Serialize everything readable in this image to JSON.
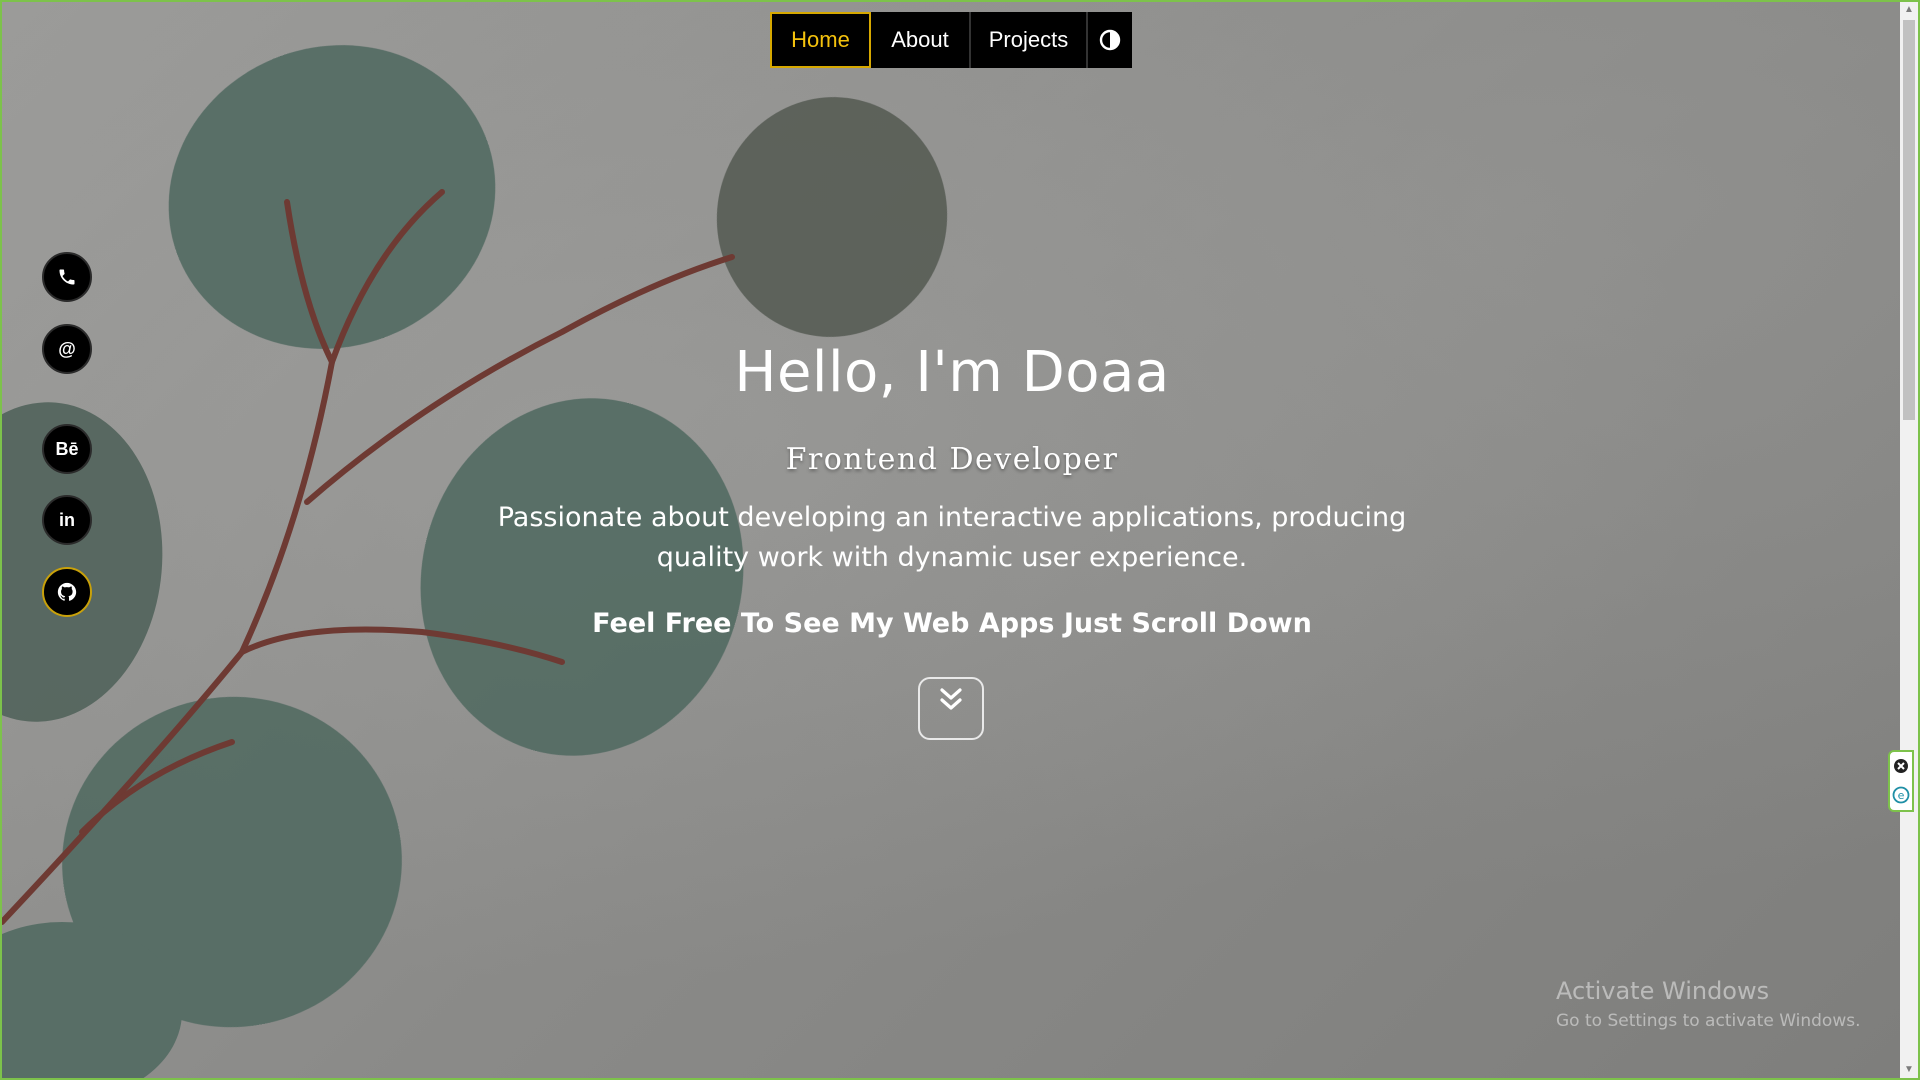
{
  "nav": {
    "items": [
      "Home",
      "About",
      "Projects"
    ],
    "active": "Home",
    "theme_toggle_icon": "contrast-icon"
  },
  "social": [
    {
      "name": "phone",
      "icon": "phone-icon"
    },
    {
      "name": "email",
      "icon": "at-icon",
      "label": "@"
    },
    {
      "name": "behance",
      "icon": "behance-icon",
      "label": "Bē"
    },
    {
      "name": "linkedin",
      "icon": "linkedin-icon",
      "label": "in"
    },
    {
      "name": "github",
      "icon": "github-icon"
    }
  ],
  "hero": {
    "title": "Hello, I'm Doaa",
    "role": "Frontend Developer",
    "description": "Passionate about developing an interactive applications, producing quality work with dynamic user experience.",
    "cta": "Feel Free To See My Web Apps Just Scroll Down",
    "scroll_icon": "double-chevron-down-icon"
  },
  "watermark": {
    "title": "Activate Windows",
    "subtitle": "Go to Settings to activate Windows."
  },
  "colors": {
    "accent": "#f4c20d",
    "nav_bg": "#000000",
    "frame": "#7dc24b"
  }
}
